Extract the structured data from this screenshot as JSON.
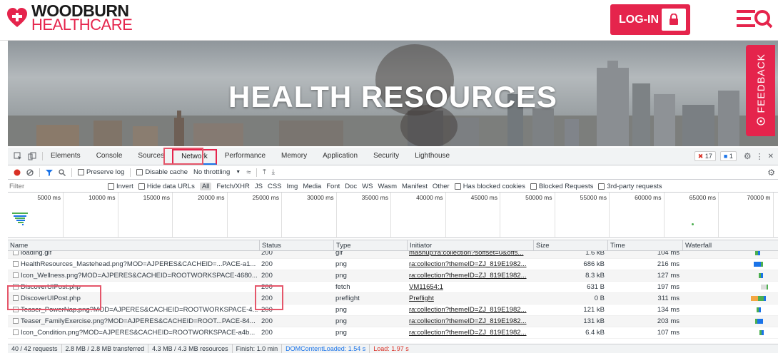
{
  "site": {
    "logo_line1": "WOODBURN",
    "logo_line2": "HEALTHCARE",
    "login_label": "LOG-IN",
    "hero_title": "HEALTH RESOURCES",
    "feedback_label": "FEEDBACK",
    "brand_color": "#e5244c"
  },
  "devtools": {
    "tabs": [
      "Elements",
      "Console",
      "Sources",
      "Network",
      "Performance",
      "Memory",
      "Application",
      "Security",
      "Lighthouse"
    ],
    "active_tab": "Network",
    "error_count": "17",
    "message_count": "1",
    "toolbar": {
      "preserve_log": "Preserve log",
      "disable_cache": "Disable cache",
      "throttling": "No throttling"
    },
    "filter": {
      "placeholder": "Filter",
      "invert": "Invert",
      "hide_data_urls": "Hide data URLs",
      "types": [
        "All",
        "Fetch/XHR",
        "JS",
        "CSS",
        "Img",
        "Media",
        "Font",
        "Doc",
        "WS",
        "Wasm",
        "Manifest",
        "Other"
      ],
      "selected_type": "All",
      "has_blocked_cookies": "Has blocked cookies",
      "blocked_requests": "Blocked Requests",
      "third_party": "3rd-party requests"
    },
    "timeline_ticks": [
      "5000 ms",
      "10000 ms",
      "15000 ms",
      "20000 ms",
      "25000 ms",
      "30000 ms",
      "35000 ms",
      "40000 ms",
      "45000 ms",
      "50000 ms",
      "55000 ms",
      "60000 ms",
      "65000 ms",
      "70000 m"
    ],
    "columns": {
      "name": "Name",
      "status": "Status",
      "type": "Type",
      "initiator": "Initiator",
      "size": "Size",
      "time": "Time",
      "waterfall": "Waterfall"
    },
    "rows": [
      {
        "name": "loading.gif",
        "status": "200",
        "type": "gif",
        "initiator": "mashup:ra:collection?soffset=0&offs...",
        "size": "1.6 kB",
        "time": "104 ms"
      },
      {
        "name": "HealthResources_Mastehead.png?MOD=AJPERES&CACHEID=...PACE-a1...",
        "status": "200",
        "type": "png",
        "initiator": "ra:collection?themeID=ZJ_819E1982...",
        "size": "686 kB",
        "time": "216 ms"
      },
      {
        "name": "Icon_Wellness.png?MOD=AJPERES&CACHEID=ROOTWORKSPACE-4680...",
        "status": "200",
        "type": "png",
        "initiator": "ra:collection?themeID=ZJ_819E1982...",
        "size": "8.3 kB",
        "time": "127 ms"
      },
      {
        "name": "DiscoverUIPost.php",
        "status": "200",
        "type": "fetch",
        "initiator": "VM11654:1",
        "size": "631 B",
        "time": "197 ms"
      },
      {
        "name": "DiscoverUIPost.php",
        "status": "200",
        "type": "preflight",
        "initiator": "Preflight",
        "size": "0 B",
        "time": "311 ms"
      },
      {
        "name": "Teaser_PowerNap.png?MOD=AJPERES&CACHEID=ROOTWORKSPACE-4...",
        "status": "200",
        "type": "png",
        "initiator": "ra:collection?themeID=ZJ_819E1982...",
        "size": "121 kB",
        "time": "134 ms"
      },
      {
        "name": "Teaser_FamilyExercise.png?MOD=AJPERES&CACHEID=ROOT...PACE-84...",
        "status": "200",
        "type": "png",
        "initiator": "ra:collection?themeID=ZJ_819E1982...",
        "size": "131 kB",
        "time": "203 ms"
      },
      {
        "name": "Icon_Condition.png?MOD=AJPERES&CACHEID=ROOTWORKSPACE-a4b...",
        "status": "200",
        "type": "png",
        "initiator": "ra:collection?themeID=ZJ_819E1982...",
        "size": "6.4 kB",
        "time": "107 ms"
      }
    ],
    "status_bar": {
      "requests": "40 / 42 requests",
      "transferred": "2.8 MB / 2.8 MB transferred",
      "resources": "4.3 MB / 4.3 MB resources",
      "finish": "Finish: 1.0 min",
      "dom_content_loaded": "DOMContentLoaded: 1.54 s",
      "load": "Load: 1.97 s"
    }
  }
}
